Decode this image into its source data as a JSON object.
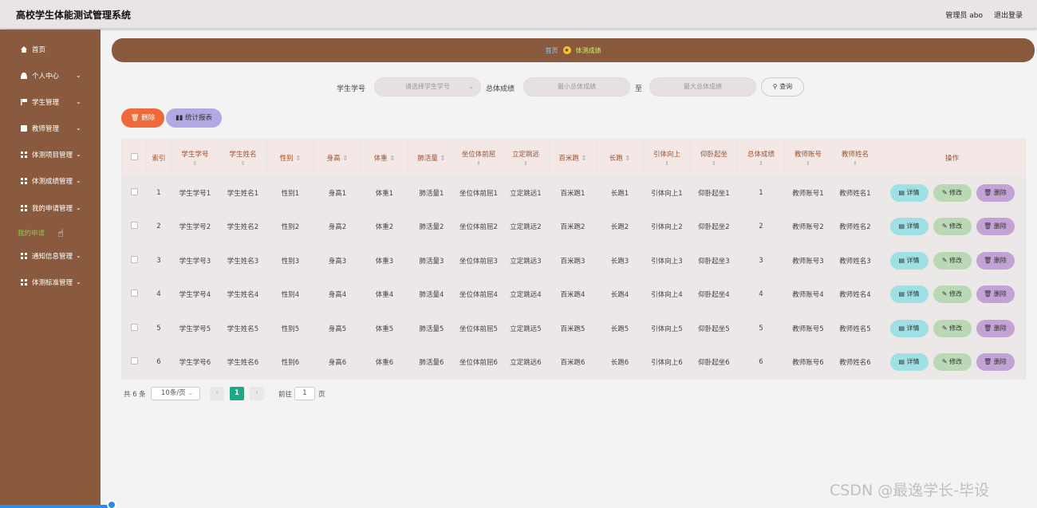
{
  "header": {
    "title": "高校学生体能测试管理系统",
    "user": "管理员 abo",
    "logout": "退出登录"
  },
  "sidebar": {
    "items": [
      {
        "label": "首页",
        "icon": "home-icon"
      },
      {
        "label": "个人中心",
        "icon": "user-icon"
      },
      {
        "label": "学生管理",
        "icon": "flag-icon"
      },
      {
        "label": "教师管理",
        "icon": "briefcase-icon"
      },
      {
        "label": "体测项目管理",
        "icon": "grid-icon"
      },
      {
        "label": "体测成绩管理",
        "icon": "grid-icon"
      },
      {
        "label": "我的申请管理",
        "icon": "grid-icon"
      },
      {
        "label": "通知信息管理",
        "icon": "grid-icon"
      },
      {
        "label": "体测标准管理",
        "icon": "grid-icon"
      }
    ],
    "sub_item": "我的申请"
  },
  "breadcrumb": {
    "home": "首页",
    "current": "体测成绩"
  },
  "search": {
    "student_id_label": "学生学号",
    "student_id_placeholder": "请选择学生学号",
    "score_label": "总体成绩",
    "min_placeholder": "最小总体成绩",
    "to": "至",
    "max_placeholder": "最大总体成绩",
    "query": "查询"
  },
  "actions": {
    "delete": "删除",
    "stats": "统计报表"
  },
  "table": {
    "columns": [
      "索引",
      "学生学号",
      "学生姓名",
      "性别",
      "身高",
      "体重",
      "肺活量",
      "坐位体前屈",
      "立定跳远",
      "百米跑",
      "长跑",
      "引体向上",
      "仰卧起坐",
      "总体成绩",
      "教师账号",
      "教师姓名"
    ],
    "ops_header": "操作",
    "ops": {
      "detail": "详情",
      "edit": "修改",
      "remove": "删除"
    },
    "rows": [
      [
        "1",
        "学生学号1",
        "学生姓名1",
        "性别1",
        "身高1",
        "体重1",
        "肺活量1",
        "坐位体前屈1",
        "立定跳远1",
        "百米跑1",
        "长跑1",
        "引体向上1",
        "仰卧起坐1",
        "1",
        "教师账号1",
        "教师姓名1"
      ],
      [
        "2",
        "学生学号2",
        "学生姓名2",
        "性别2",
        "身高2",
        "体重2",
        "肺活量2",
        "坐位体前屈2",
        "立定跳远2",
        "百米跑2",
        "长跑2",
        "引体向上2",
        "仰卧起坐2",
        "2",
        "教师账号2",
        "教师姓名2"
      ],
      [
        "3",
        "学生学号3",
        "学生姓名3",
        "性别3",
        "身高3",
        "体重3",
        "肺活量3",
        "坐位体前屈3",
        "立定跳远3",
        "百米跑3",
        "长跑3",
        "引体向上3",
        "仰卧起坐3",
        "3",
        "教师账号3",
        "教师姓名3"
      ],
      [
        "4",
        "学生学号4",
        "学生姓名4",
        "性别4",
        "身高4",
        "体重4",
        "肺活量4",
        "坐位体前屈4",
        "立定跳远4",
        "百米跑4",
        "长跑4",
        "引体向上4",
        "仰卧起坐4",
        "4",
        "教师账号4",
        "教师姓名4"
      ],
      [
        "5",
        "学生学号5",
        "学生姓名5",
        "性别5",
        "身高5",
        "体重5",
        "肺活量5",
        "坐位体前屈5",
        "立定跳远5",
        "百米跑5",
        "长跑5",
        "引体向上5",
        "仰卧起坐5",
        "5",
        "教师账号5",
        "教师姓名5"
      ],
      [
        "6",
        "学生学号6",
        "学生姓名6",
        "性别6",
        "身高6",
        "体重6",
        "肺活量6",
        "坐位体前屈6",
        "立定跳远6",
        "百米跑6",
        "长跑6",
        "引体向上6",
        "仰卧起坐6",
        "6",
        "教师账号6",
        "教师姓名6"
      ]
    ]
  },
  "pager": {
    "total": "共 6 条",
    "page_size": "10条/页",
    "current_page": "1",
    "goto": "前往",
    "goto_value": "1",
    "page_unit": "页"
  },
  "watermark": "CSDN @最逸学长-毕设"
}
